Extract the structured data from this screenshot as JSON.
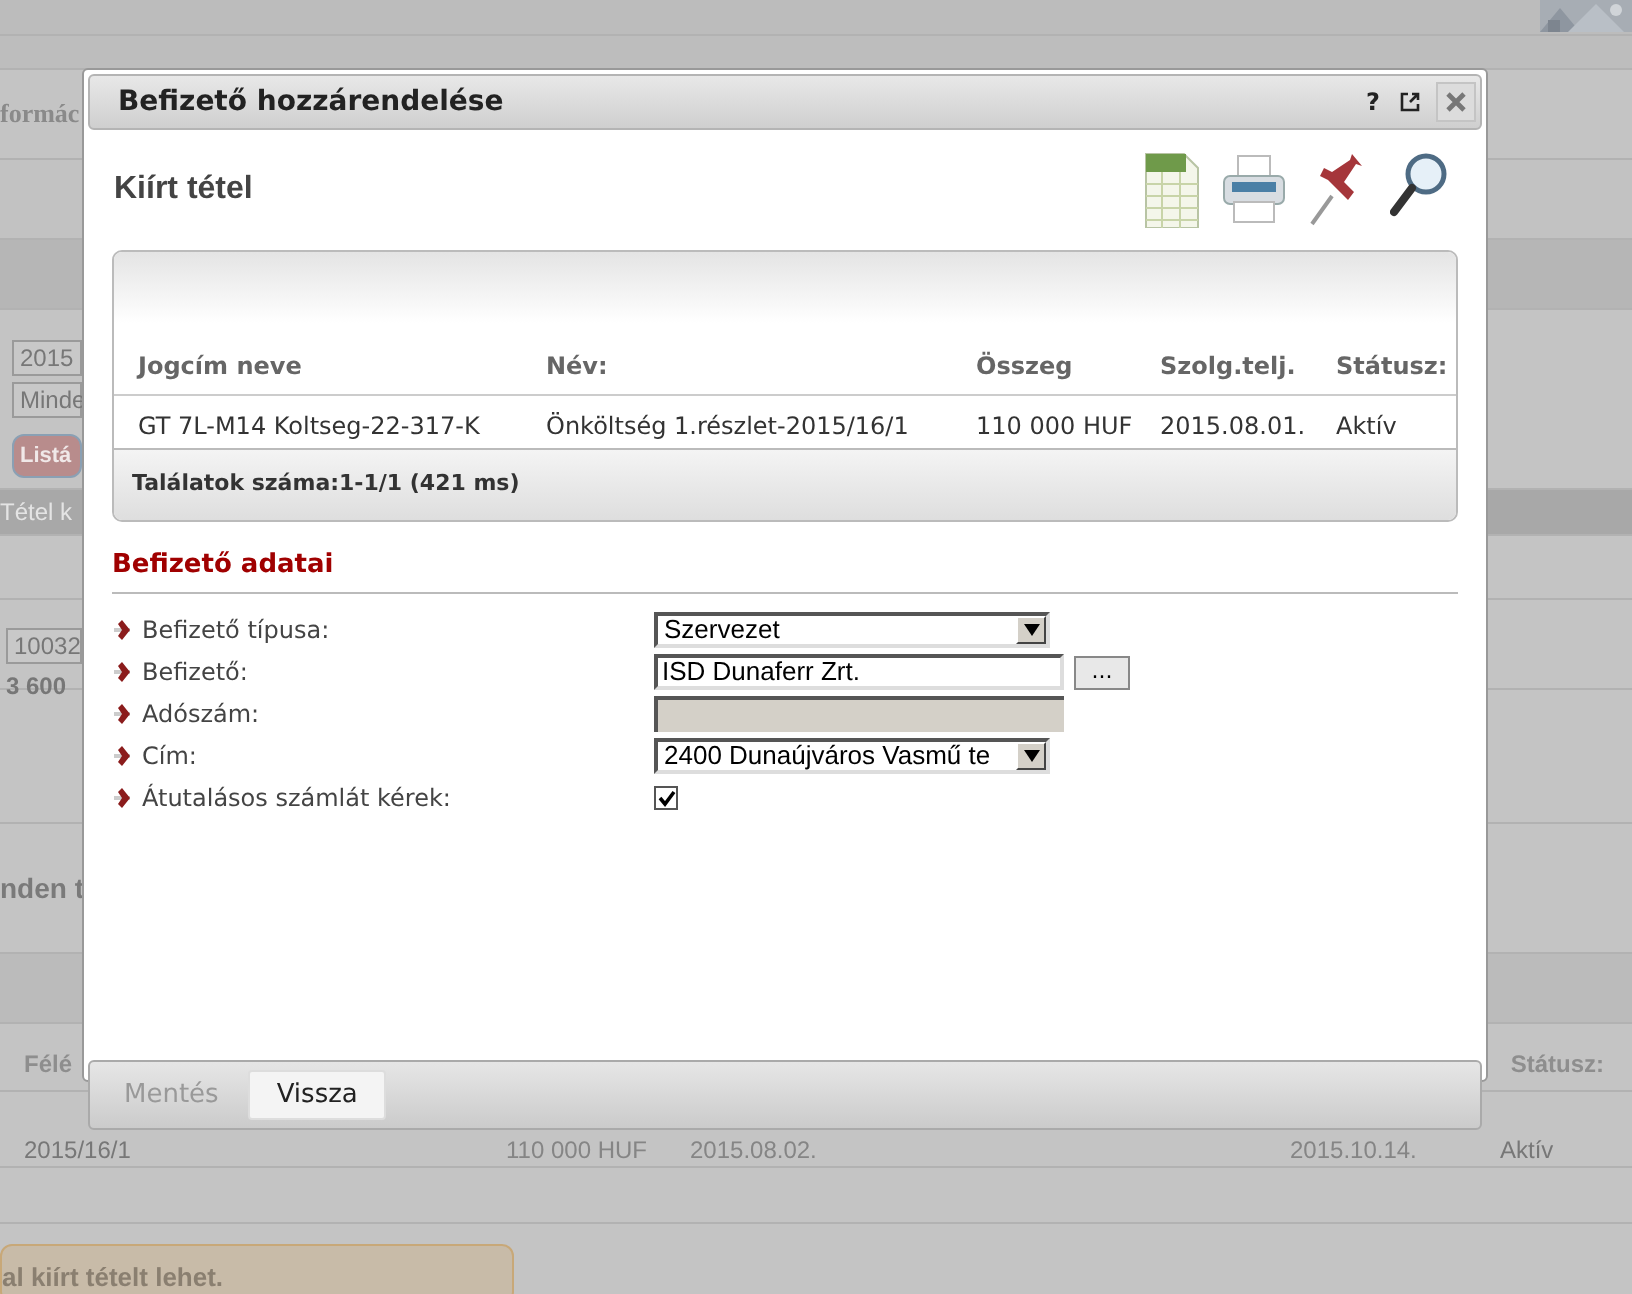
{
  "background": {
    "heading_fragment": "formác",
    "year_field": "2015",
    "filter_field": "Minde",
    "list_button": "Listá",
    "tab_fragment": "Tétel k",
    "code_field": "10032",
    "amount_fragment": "3 600",
    "section_fragment": "nden t",
    "table": {
      "columns": [
        "Félé",
        "Státusz:"
      ],
      "row": [
        "2015/16/1",
        "110 000 HUF",
        "2015.08.02.",
        "2015.10.14.",
        "Aktív"
      ]
    },
    "notice": "al kiírt tételt lehet."
  },
  "dialog": {
    "title": "Befizető hozzárendelése",
    "title_buttons": [
      "?"
    ],
    "heading": "Kiírt tétel",
    "table": {
      "columns": [
        "Jogcím neve",
        "Név:",
        "Összeg",
        "Szolg.telj.",
        "Státusz:"
      ],
      "rows": [
        [
          "GT 7L-M14 Koltseg-22-317-K",
          "Önköltség 1.részlet-2015/16/1",
          "110 000 HUF",
          "2015.08.01.",
          "Aktív"
        ]
      ],
      "footer": "Találatok száma:1-1/1 (421 ms)"
    },
    "section_title": "Befizető adatai",
    "fields": [
      {
        "label": "Befizető típusa:",
        "kind": "select",
        "value": "Szervezet"
      },
      {
        "label": "Befizető:",
        "kind": "lookup",
        "value": "ISD Dunaferr Zrt.",
        "button": "..."
      },
      {
        "label": "Adószám:",
        "kind": "readonly"
      },
      {
        "label": "Cím:",
        "kind": "select",
        "value": "2400 Dunaújváros Vasmű te"
      },
      {
        "label": "Átutalásos számlát kérek:",
        "kind": "checkbox",
        "checked": true
      }
    ],
    "buttons": [
      {
        "label": "Mentés",
        "disabled": true
      },
      {
        "label": "Vissza",
        "disabled": false
      }
    ]
  }
}
